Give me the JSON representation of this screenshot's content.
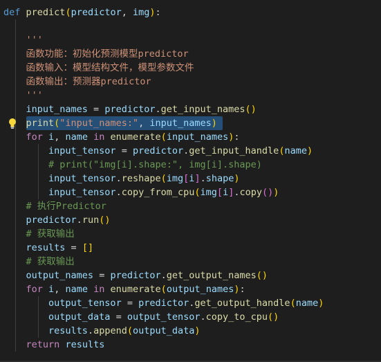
{
  "editor": {
    "lines": [
      [
        {
          "t": "def",
          "c": "kw"
        },
        {
          "t": " "
        },
        {
          "t": "predict",
          "c": "fn"
        },
        {
          "t": "(",
          "c": "br1"
        },
        {
          "t": "predictor",
          "c": "var"
        },
        {
          "t": ", "
        },
        {
          "t": "img",
          "c": "var"
        },
        {
          "t": ")",
          "c": "br1"
        },
        {
          "t": ":"
        }
      ],
      [],
      [
        {
          "t": "    '''",
          "c": "str"
        }
      ],
      [
        {
          "t": "    函数功能：初始化预测模型predictor",
          "c": "str"
        }
      ],
      [
        {
          "t": "    函数输入：模型结构文件，模型参数文件",
          "c": "str"
        }
      ],
      [
        {
          "t": "    函数输出：预测器predictor",
          "c": "str"
        }
      ],
      [
        {
          "t": "    '''",
          "c": "str"
        }
      ],
      [
        {
          "t": "    "
        },
        {
          "t": "input_names",
          "c": "var"
        },
        {
          "t": " = "
        },
        {
          "t": "predictor",
          "c": "var"
        },
        {
          "t": "."
        },
        {
          "t": "get_input_names",
          "c": "fn"
        },
        {
          "t": "()",
          "c": "br1"
        }
      ],
      [
        {
          "t": "    "
        },
        {
          "t": "print",
          "c": "fn"
        },
        {
          "t": "(",
          "c": "br1"
        },
        {
          "t": "\"input_names:\"",
          "c": "str"
        },
        {
          "t": ", "
        },
        {
          "t": "input_names",
          "c": "var"
        },
        {
          "t": ")",
          "c": "br1"
        }
      ],
      [
        {
          "t": "    "
        },
        {
          "t": "for",
          "c": "ctl"
        },
        {
          "t": " "
        },
        {
          "t": "i",
          "c": "var"
        },
        {
          "t": ", "
        },
        {
          "t": "name",
          "c": "var"
        },
        {
          "t": " "
        },
        {
          "t": "in",
          "c": "ctl"
        },
        {
          "t": " "
        },
        {
          "t": "enumerate",
          "c": "fn"
        },
        {
          "t": "(",
          "c": "br1"
        },
        {
          "t": "input_names",
          "c": "var"
        },
        {
          "t": ")",
          "c": "br1"
        },
        {
          "t": ":"
        }
      ],
      [
        {
          "t": "        "
        },
        {
          "t": "input_tensor",
          "c": "var"
        },
        {
          "t": " = "
        },
        {
          "t": "predictor",
          "c": "var"
        },
        {
          "t": "."
        },
        {
          "t": "get_input_handle",
          "c": "fn"
        },
        {
          "t": "(",
          "c": "br1"
        },
        {
          "t": "name",
          "c": "var"
        },
        {
          "t": ")",
          "c": "br1"
        }
      ],
      [
        {
          "t": "        "
        },
        {
          "t": "# print(\"img[i].shape:\", img[i].shape)",
          "c": "cm"
        }
      ],
      [
        {
          "t": "        "
        },
        {
          "t": "input_tensor",
          "c": "var"
        },
        {
          "t": "."
        },
        {
          "t": "reshape",
          "c": "fn"
        },
        {
          "t": "(",
          "c": "br1"
        },
        {
          "t": "img",
          "c": "var"
        },
        {
          "t": "[",
          "c": "br2"
        },
        {
          "t": "i",
          "c": "var"
        },
        {
          "t": "]",
          "c": "br2"
        },
        {
          "t": "."
        },
        {
          "t": "shape",
          "c": "var"
        },
        {
          "t": ")",
          "c": "br1"
        }
      ],
      [
        {
          "t": "        "
        },
        {
          "t": "input_tensor",
          "c": "var"
        },
        {
          "t": "."
        },
        {
          "t": "copy_from_cpu",
          "c": "fn"
        },
        {
          "t": "(",
          "c": "br1"
        },
        {
          "t": "img",
          "c": "var"
        },
        {
          "t": "[",
          "c": "br2"
        },
        {
          "t": "i",
          "c": "var"
        },
        {
          "t": "]",
          "c": "br2"
        },
        {
          "t": "."
        },
        {
          "t": "copy",
          "c": "fn"
        },
        {
          "t": "()",
          "c": "br2"
        },
        {
          "t": ")",
          "c": "br1"
        }
      ],
      [
        {
          "t": "    "
        },
        {
          "t": "# 执行Predictor",
          "c": "cm"
        }
      ],
      [
        {
          "t": "    "
        },
        {
          "t": "predictor",
          "c": "var"
        },
        {
          "t": "."
        },
        {
          "t": "run",
          "c": "fn"
        },
        {
          "t": "()",
          "c": "br1"
        }
      ],
      [
        {
          "t": "    "
        },
        {
          "t": "# 获取输出",
          "c": "cm"
        }
      ],
      [
        {
          "t": "    "
        },
        {
          "t": "results",
          "c": "var"
        },
        {
          "t": " = "
        },
        {
          "t": "[]",
          "c": "br1"
        }
      ],
      [
        {
          "t": "    "
        },
        {
          "t": "# 获取输出",
          "c": "cm"
        }
      ],
      [
        {
          "t": "    "
        },
        {
          "t": "output_names",
          "c": "var"
        },
        {
          "t": " = "
        },
        {
          "t": "predictor",
          "c": "var"
        },
        {
          "t": "."
        },
        {
          "t": "get_output_names",
          "c": "fn"
        },
        {
          "t": "()",
          "c": "br1"
        }
      ],
      [
        {
          "t": "    "
        },
        {
          "t": "for",
          "c": "ctl"
        },
        {
          "t": " "
        },
        {
          "t": "i",
          "c": "var"
        },
        {
          "t": ", "
        },
        {
          "t": "name",
          "c": "var"
        },
        {
          "t": " "
        },
        {
          "t": "in",
          "c": "ctl"
        },
        {
          "t": " "
        },
        {
          "t": "enumerate",
          "c": "fn"
        },
        {
          "t": "(",
          "c": "br1"
        },
        {
          "t": "output_names",
          "c": "var"
        },
        {
          "t": ")",
          "c": "br1"
        },
        {
          "t": ":"
        }
      ],
      [
        {
          "t": "        "
        },
        {
          "t": "output_tensor",
          "c": "var"
        },
        {
          "t": " = "
        },
        {
          "t": "predictor",
          "c": "var"
        },
        {
          "t": "."
        },
        {
          "t": "get_output_handle",
          "c": "fn"
        },
        {
          "t": "(",
          "c": "br1"
        },
        {
          "t": "name",
          "c": "var"
        },
        {
          "t": ")",
          "c": "br1"
        }
      ],
      [
        {
          "t": "        "
        },
        {
          "t": "output_data",
          "c": "var"
        },
        {
          "t": " = "
        },
        {
          "t": "output_tensor",
          "c": "var"
        },
        {
          "t": "."
        },
        {
          "t": "copy_to_cpu",
          "c": "fn"
        },
        {
          "t": "()",
          "c": "br1"
        }
      ],
      [
        {
          "t": "        "
        },
        {
          "t": "results",
          "c": "var"
        },
        {
          "t": "."
        },
        {
          "t": "append",
          "c": "fn"
        },
        {
          "t": "(",
          "c": "br1"
        },
        {
          "t": "output_data",
          "c": "var"
        },
        {
          "t": ")",
          "c": "br1"
        }
      ],
      [
        {
          "t": "    "
        },
        {
          "t": "return",
          "c": "ctl"
        },
        {
          "t": " "
        },
        {
          "t": "results",
          "c": "var"
        }
      ]
    ],
    "selected_line": 8,
    "lightbulb_line": 8,
    "lightbulb_icon": "lightbulb-icon"
  }
}
